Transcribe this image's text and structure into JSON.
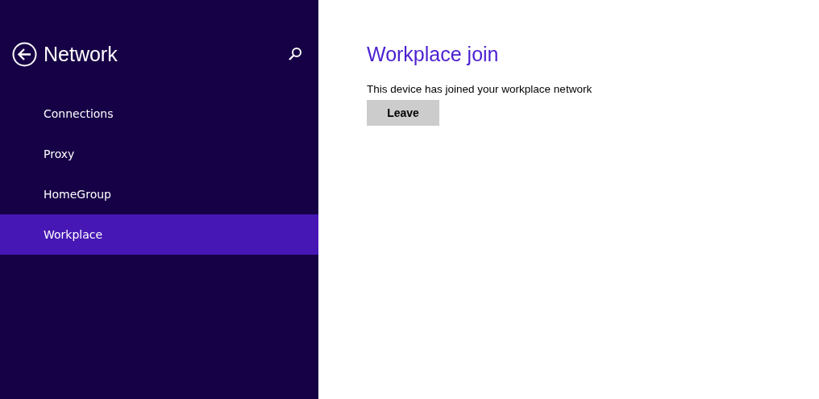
{
  "sidebar": {
    "title": "Network",
    "items": [
      {
        "label": "Connections",
        "selected": false
      },
      {
        "label": "Proxy",
        "selected": false
      },
      {
        "label": "HomeGroup",
        "selected": false
      },
      {
        "label": "Workplace",
        "selected": true
      }
    ]
  },
  "content": {
    "heading": "Workplace join",
    "message": "This device has joined your workplace network",
    "button": "Leave"
  }
}
